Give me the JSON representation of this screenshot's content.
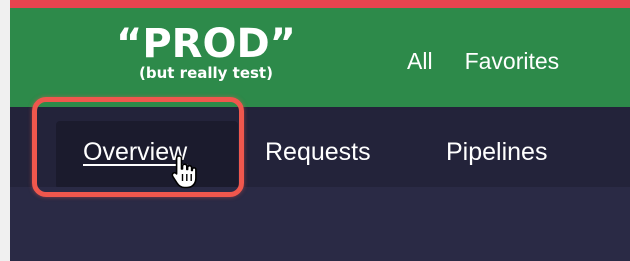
{
  "header": {
    "logo_main": "“PROD”",
    "logo_sub": "(but really test)",
    "nav": [
      {
        "label": "All"
      },
      {
        "label": "Favorites"
      }
    ]
  },
  "subnav": {
    "items": [
      {
        "label": "Overview",
        "active": true
      },
      {
        "label": "Requests"
      },
      {
        "label": "Pipelines"
      }
    ]
  },
  "colors": {
    "accent_stripe": "#e8444f",
    "header_green": "#2d8a4a",
    "subnav_bg": "#23233a",
    "highlight": "#f0574d"
  },
  "icons": {
    "cursor": "hand-pointer-icon"
  }
}
